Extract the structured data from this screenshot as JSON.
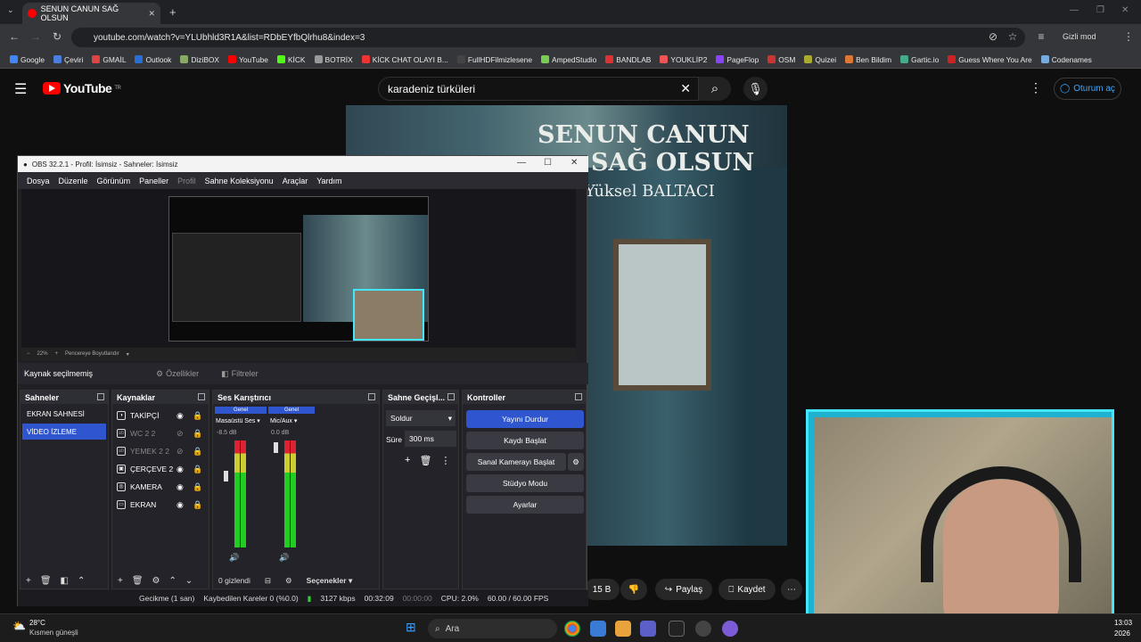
{
  "browser": {
    "tab_title": "SENUN CANUN SAĞ OLSUN",
    "url": "youtube.com/watch?v=YLUbhld3R1A&list=RDbEYfbQlrhu8&index=3",
    "profile": "Gizli mod",
    "bookmarks": [
      "Google",
      "Çeviri",
      "GMAİL",
      "Outlook",
      "DiziBOX",
      "YouTube",
      "KİCK",
      "BOTRİX",
      "KİCK CHAT OLAYI B...",
      "FullHDFilmizlesene",
      "AmpedStudio",
      "BANDLAB",
      "YOUKLİP2",
      "PageFlop",
      "OSM",
      "Quizei",
      "Ben Bildim",
      "Gartic.io",
      "Guess Where You Are",
      "Codenames"
    ]
  },
  "youtube": {
    "logo": "YouTube",
    "region": "TR",
    "search_query": "karadeniz türküleri",
    "signin": "Oturum aç",
    "video_title_line1": "SENUN CANUN",
    "video_title_line2": "SAĞ OLSUN",
    "video_artist": "Yüksel BALTACI",
    "likes": "15 B",
    "share": "Paylaş",
    "save": "Kaydet"
  },
  "obs": {
    "title": "OBS 32.2.1 - Profil: İsimsiz - Sahneler: İsimsiz",
    "menu": [
      "Dosya",
      "Düzenle",
      "Görünüm",
      "Paneller",
      "Profil",
      "Sahne Koleksiyonu",
      "Araçlar",
      "Yardım"
    ],
    "zoom": "22%",
    "fit": "Pencereye Boyutlandır",
    "no_source": "Kaynak seçilmemiş",
    "properties": "Özellikler",
    "filters": "Filtreler",
    "scenes_header": "Sahneler",
    "scenes": [
      "EKRAN SAHNESİ",
      "VİDEO İZLEME"
    ],
    "sources_header": "Kaynaklar",
    "sources": [
      "TAKİPÇİ",
      "WC 2 2",
      "YEMEK 2 2",
      "ÇERÇEVE 2",
      "KAMERA",
      "EKRAN"
    ],
    "mixer_header": "Ses Karıştırıcı",
    "mixer_tag": "Genel",
    "ch1_name": "Masaüstü Ses",
    "ch1_db": "-8.5 dB",
    "ch2_name": "Mic/Aux",
    "ch2_db": "0.0 dB",
    "hidden": "0 gizlendi",
    "options": "Seçenekler",
    "transition_header": "Sahne Geçişl...",
    "transition": "Soldur",
    "duration_label": "Süre",
    "duration": "300 ms",
    "controls_header": "Kontroller",
    "stop_stream": "Yayını Durdur",
    "start_record": "Kaydı Başlat",
    "virtual_cam": "Sanal Kamerayı Başlat",
    "studio": "Stüdyo Modu",
    "settings": "Ayarlar",
    "status_delay": "Gecikme (1 san)",
    "status_dropped": "Kaybedilen Kareler 0 (%0.0)",
    "status_kbps": "3127 kbps",
    "status_time": "00:32:09",
    "status_rec": "00:00:00",
    "status_cpu": "CPU: 2.0%",
    "status_fps": "60.00 / 60.00 FPS"
  },
  "taskbar": {
    "temp": "28°C",
    "weather": "Kısmen güneşli",
    "search": "Ara",
    "clock": "13:03",
    "year": "2026"
  },
  "colors": {
    "accent": "#2f56cf",
    "yt_red": "#ff0000",
    "cam_border": "#42e6ff"
  }
}
